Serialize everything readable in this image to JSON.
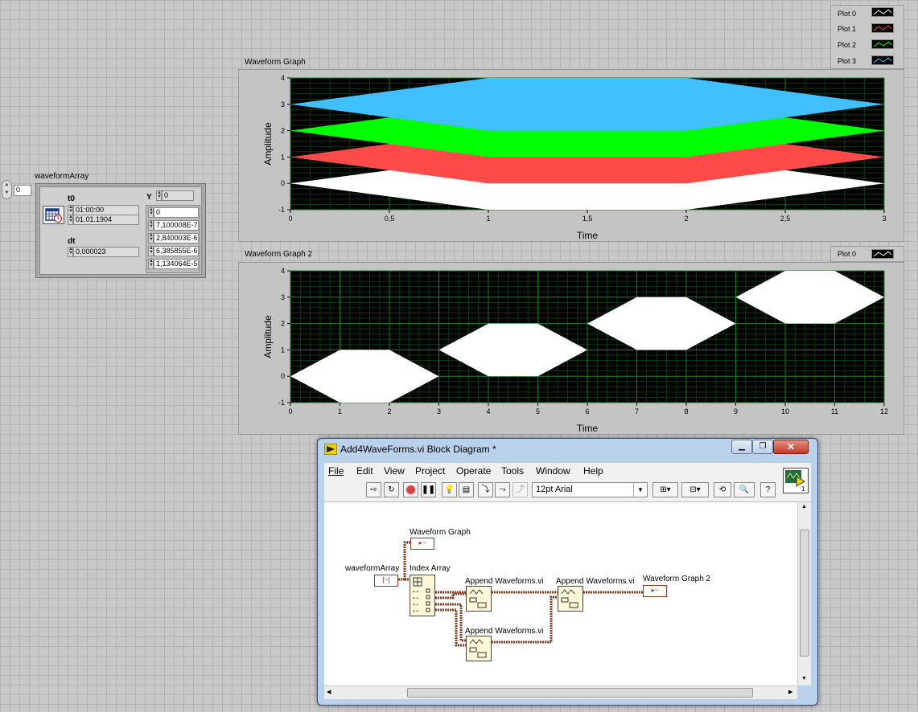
{
  "front_panel": {
    "index_value": "0",
    "cluster_label": "waveformArray",
    "t0_label": "t0",
    "t0_time": "01:00:00",
    "t0_date": "01.01.1904",
    "dt_label": "dt",
    "dt_value": "0,000023",
    "y_label": "Y",
    "y_index": "0",
    "y_values": [
      "0",
      "7,100008E-7",
      "2,840003E-6",
      "6,385855E-6",
      "1,134064E-5"
    ]
  },
  "graph1": {
    "title": "Waveform Graph",
    "legend": [
      {
        "name": "Plot 0",
        "color": "#ffffff"
      },
      {
        "name": "Plot 1",
        "color": "#ff4a4a"
      },
      {
        "name": "Plot 2",
        "color": "#00ff00"
      },
      {
        "name": "Plot 3",
        "color": "#40c0ff"
      }
    ]
  },
  "graph2": {
    "title": "Waveform Graph 2",
    "legend": [
      {
        "name": "Plot 0",
        "color": "#ffffff"
      }
    ]
  },
  "chart_data": [
    {
      "type": "area",
      "title": "Waveform Graph",
      "xlabel": "Time",
      "ylabel": "Amplitude",
      "xlim": [
        0,
        3
      ],
      "ylim": [
        -1,
        4
      ],
      "xticks": [
        "0",
        "0,5",
        "1",
        "1,5",
        "2",
        "2,5",
        "3"
      ],
      "yticks": [
        "-1",
        "0",
        "1",
        "2",
        "3",
        "4"
      ],
      "grid": true,
      "series": [
        {
          "name": "Plot 0",
          "color": "#ffffff",
          "upper": [
            [
              0,
              0
            ],
            [
              1,
              1
            ],
            [
              2,
              1
            ],
            [
              3,
              0
            ]
          ],
          "lower": [
            [
              0,
              0
            ],
            [
              1,
              -1
            ],
            [
              2,
              -1
            ],
            [
              3,
              0
            ]
          ]
        },
        {
          "name": "Plot 1",
          "color": "#ff4a4a",
          "upper": [
            [
              0,
              1
            ],
            [
              1,
              2
            ],
            [
              2,
              2
            ],
            [
              3,
              1
            ]
          ],
          "lower": [
            [
              0,
              1
            ],
            [
              1,
              0
            ],
            [
              2,
              0
            ],
            [
              3,
              1
            ]
          ]
        },
        {
          "name": "Plot 2",
          "color": "#00ff00",
          "upper": [
            [
              0,
              2
            ],
            [
              1,
              3
            ],
            [
              2,
              3
            ],
            [
              3,
              2
            ]
          ],
          "lower": [
            [
              0,
              2
            ],
            [
              1,
              1
            ],
            [
              2,
              1
            ],
            [
              3,
              2
            ]
          ]
        },
        {
          "name": "Plot 3",
          "color": "#40c0ff",
          "upper": [
            [
              0,
              3
            ],
            [
              1,
              4
            ],
            [
              2,
              4
            ],
            [
              3,
              3
            ]
          ],
          "lower": [
            [
              0,
              3
            ],
            [
              1,
              2
            ],
            [
              2,
              2
            ],
            [
              3,
              3
            ]
          ]
        }
      ]
    },
    {
      "type": "area",
      "title": "Waveform Graph 2",
      "xlabel": "Time",
      "ylabel": "Amplitude",
      "xlim": [
        0,
        12
      ],
      "ylim": [
        -1,
        4
      ],
      "xticks": [
        "0",
        "1",
        "2",
        "3",
        "4",
        "5",
        "6",
        "7",
        "8",
        "9",
        "10",
        "11",
        "12"
      ],
      "yticks": [
        "-1",
        "0",
        "1",
        "2",
        "3",
        "4"
      ],
      "grid": true,
      "series": [
        {
          "name": "Plot 0",
          "color": "#ffffff",
          "upper": [
            [
              0,
              0
            ],
            [
              1,
              1
            ],
            [
              2,
              1
            ],
            [
              3,
              0
            ]
          ],
          "lower": [
            [
              0,
              0
            ],
            [
              1,
              -1
            ],
            [
              2,
              -1
            ],
            [
              3,
              0
            ]
          ]
        },
        {
          "name": "Plot 0",
          "color": "#ffffff",
          "upper": [
            [
              3,
              1
            ],
            [
              4,
              2
            ],
            [
              5,
              2
            ],
            [
              6,
              1
            ]
          ],
          "lower": [
            [
              3,
              1
            ],
            [
              4,
              0
            ],
            [
              5,
              0
            ],
            [
              6,
              1
            ]
          ]
        },
        {
          "name": "Plot 0",
          "color": "#ffffff",
          "upper": [
            [
              6,
              2
            ],
            [
              7,
              3
            ],
            [
              8,
              3
            ],
            [
              9,
              2
            ]
          ],
          "lower": [
            [
              6,
              2
            ],
            [
              7,
              1
            ],
            [
              8,
              1
            ],
            [
              9,
              2
            ]
          ]
        },
        {
          "name": "Plot 0",
          "color": "#ffffff",
          "upper": [
            [
              9,
              3
            ],
            [
              10,
              4
            ],
            [
              11,
              4
            ],
            [
              12,
              3
            ]
          ],
          "lower": [
            [
              9,
              3
            ],
            [
              10,
              2
            ],
            [
              11,
              2
            ],
            [
              12,
              3
            ]
          ]
        }
      ]
    }
  ],
  "block_diagram": {
    "window_title": "Add4WaveForms.vi Block Diagram *",
    "menu": [
      "File",
      "Edit",
      "View",
      "Project",
      "Operate",
      "Tools",
      "Window",
      "Help"
    ],
    "font_select": "12pt Arial",
    "labels": {
      "waveform_array": "waveformArray",
      "waveform_graph": "Waveform Graph",
      "index_array": "Index Array",
      "append1": "Append Waveforms.vi",
      "append2": "Append Waveforms.vi",
      "append3": "Append Waveforms.vi",
      "waveform_graph2": "Waveform Graph 2"
    },
    "connector_number": "1"
  }
}
